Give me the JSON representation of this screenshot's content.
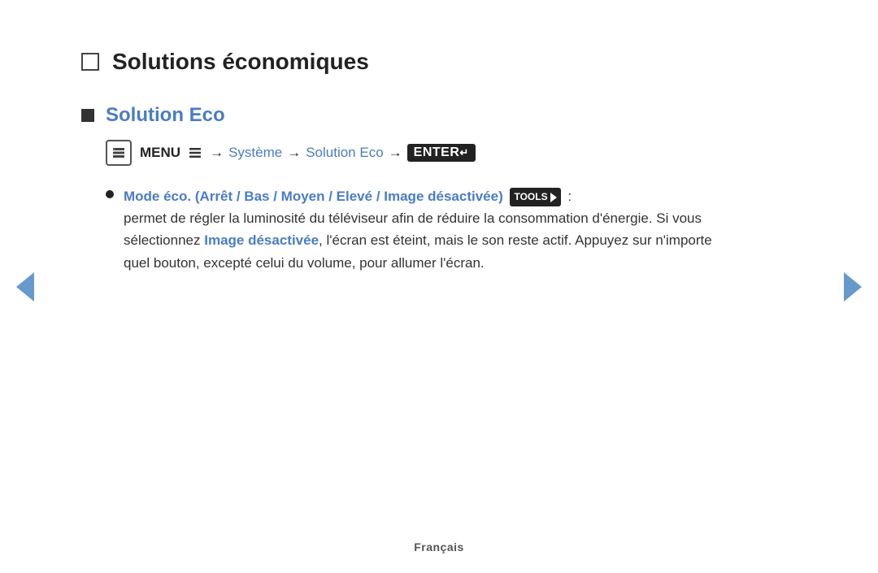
{
  "page": {
    "title": "Solutions économiques",
    "section_title": "Solution Eco",
    "menu_path": {
      "menu_icon": "☜",
      "menu_label": "MENU",
      "arrow1": "→",
      "step1": "Système",
      "arrow2": "→",
      "step2": "Solution Eco",
      "arrow3": "→",
      "enter_label": "ENTER"
    },
    "list_items": [
      {
        "title": "Mode éco. (Arrêt / Bas / Moyen / Elevé / Image désactivée)",
        "tools_label": "TOOLS",
        "colon": " :",
        "description_part1": "permet de régler la luminosité du téléviseur afin de réduire la consommation d'énergie. Si vous sélectionnez ",
        "inline_blue": "Image désactivée",
        "description_part2": ", l'écran est éteint, mais le son reste actif. Appuyez sur n'importe quel bouton, excepté celui du volume, pour allumer l'écran."
      }
    ],
    "footer": "Français"
  }
}
